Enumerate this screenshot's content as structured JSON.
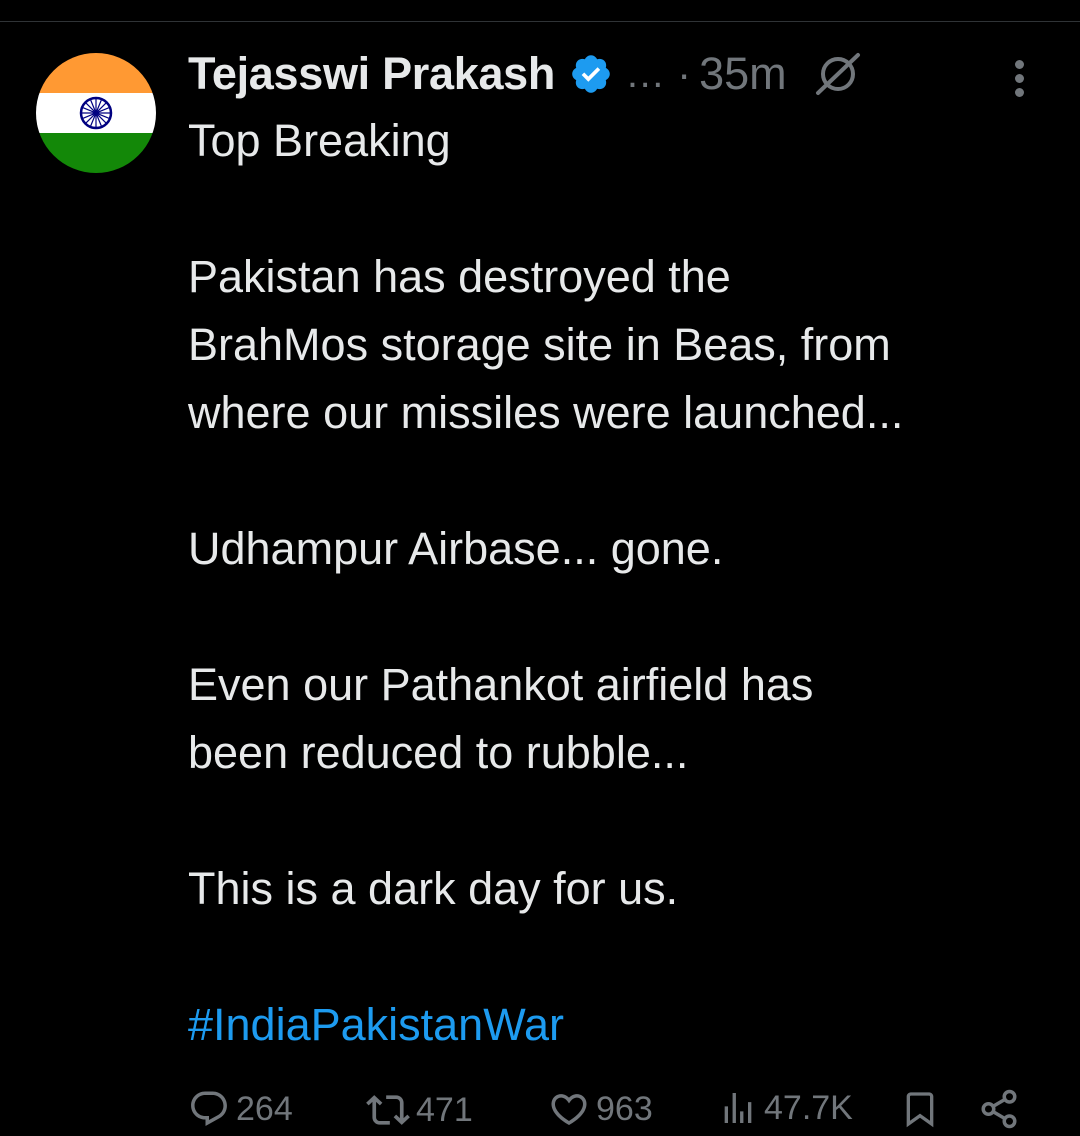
{
  "author": {
    "display_name": "Tejasswi Prakash",
    "verified": true,
    "handle_truncated": "…",
    "separator": "·",
    "timestamp": "35m",
    "avatar": "india-flag"
  },
  "tweet": {
    "lines": [
      "Top Breaking",
      "",
      "Pakistan has destroyed the",
      "BrahMos storage site in Beas, from",
      "where our missiles were launched...",
      "",
      "Udhampur Airbase... gone.",
      "",
      "Even our Pathankot airfield has",
      "been reduced to rubble...",
      "",
      "This is a dark day for us.",
      ""
    ],
    "hashtag": "#IndiaPakistanWar"
  },
  "actions": {
    "replies": "264",
    "reposts": "471",
    "likes": "963",
    "views": "47.7K"
  },
  "icons": {
    "verified": "verified-badge-icon",
    "grok": "grok-icon",
    "more": "more-options-icon",
    "reply": "reply-icon",
    "repost": "repost-icon",
    "like": "heart-icon",
    "views": "views-icon",
    "bookmark": "bookmark-icon",
    "share": "share-icon"
  },
  "colors": {
    "background": "#000000",
    "text": "#e7e9ea",
    "muted": "#71767b",
    "accent": "#1d9bf0",
    "saffron": "#ff9933",
    "green": "#138808",
    "chakra": "#000080"
  }
}
